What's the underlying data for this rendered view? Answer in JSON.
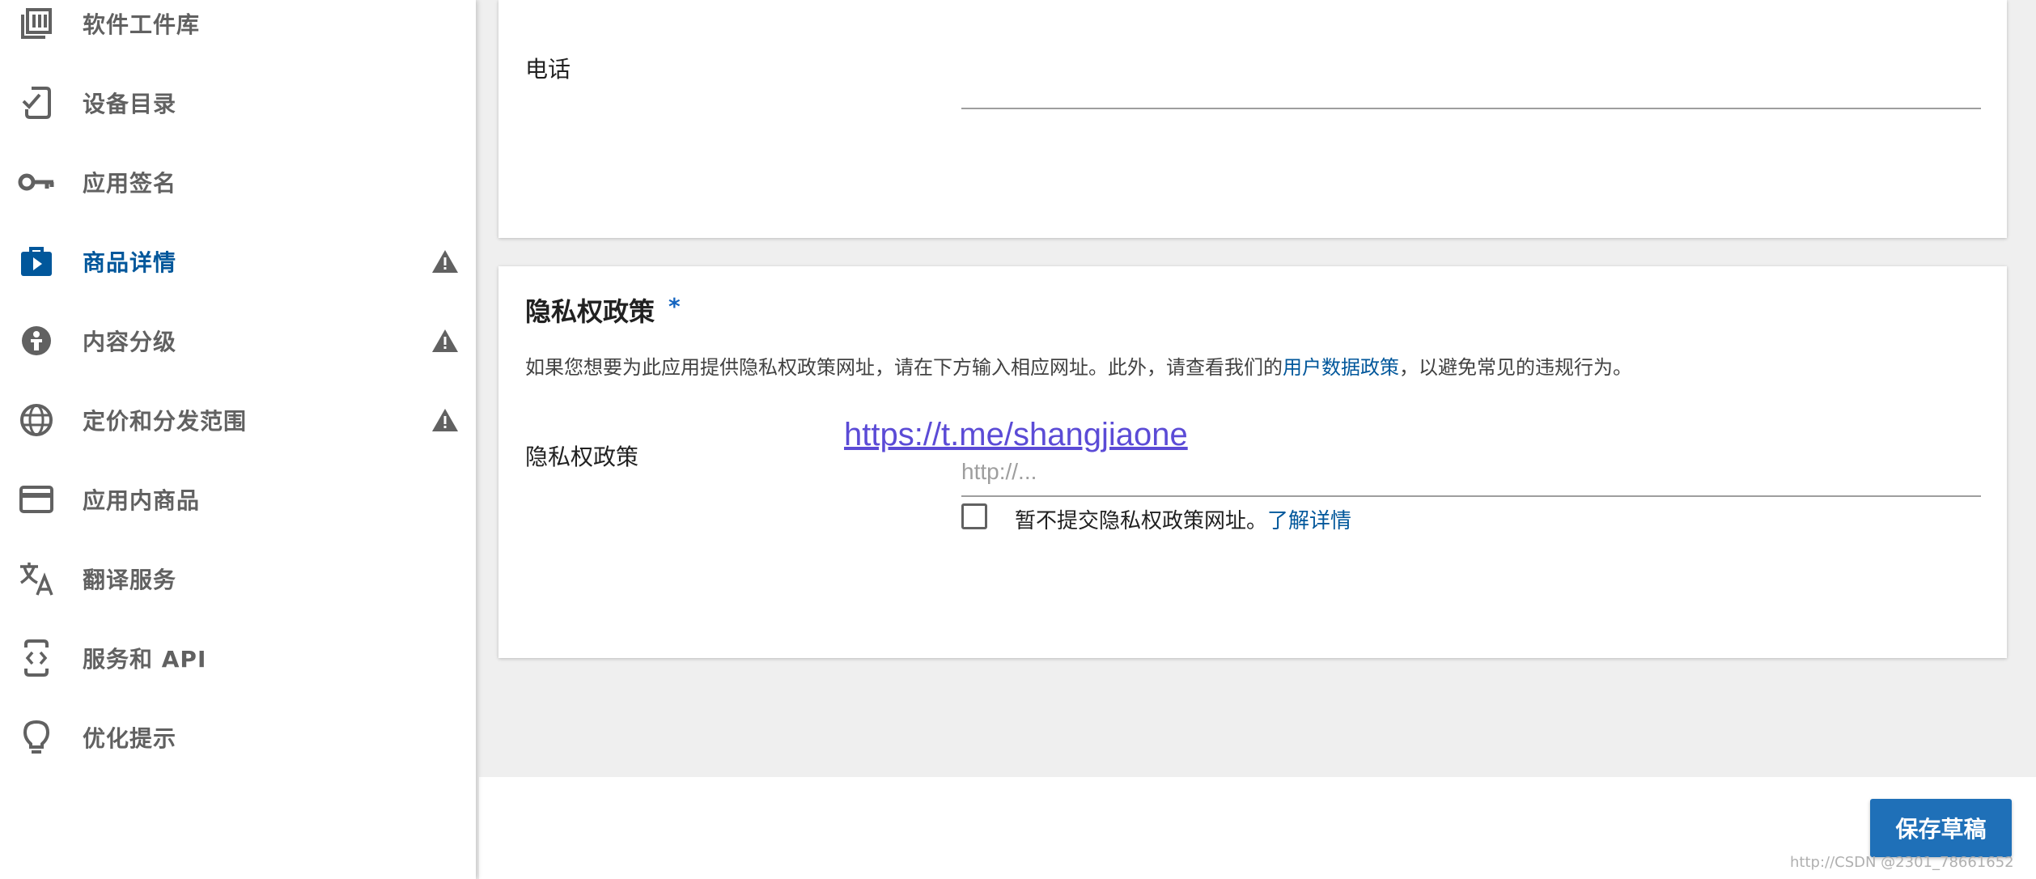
{
  "sidebar": {
    "items": [
      {
        "label": "软件工件库",
        "icon": "library-icon"
      },
      {
        "label": "设备目录",
        "icon": "device-check-icon"
      },
      {
        "label": "应用签名",
        "icon": "key-icon"
      },
      {
        "label": "商品详情",
        "icon": "store-listing-icon",
        "active": true,
        "warning": true
      },
      {
        "label": "内容分级",
        "icon": "content-rating-icon",
        "warning": true
      },
      {
        "label": "定价和分发范围",
        "icon": "globe-icon",
        "warning": true
      },
      {
        "label": "应用内商品",
        "icon": "credit-card-icon"
      },
      {
        "label": "翻译服务",
        "icon": "translate-icon"
      },
      {
        "label": "服务和 API",
        "icon": "api-icon"
      },
      {
        "label": "优化提示",
        "icon": "lightbulb-icon"
      }
    ]
  },
  "contact": {
    "phone_label": "电话"
  },
  "privacy": {
    "title": "隐私权政策",
    "required_mark": "*",
    "description_before": "如果您想要为此应用提供隐私权政策网址，请在下方输入相应网址。此外，请查看我们的",
    "description_link": "用户数据政策",
    "description_after": "，以避免常见的违规行为。",
    "field_label": "隐私权政策",
    "overlay_link": "https://t.me/shangjiaone",
    "url_placeholder": "http://...",
    "checkbox_label": "暂不提交隐私权政策网址。",
    "learn_more": "了解详情"
  },
  "footer": {
    "save_label": "保存草稿",
    "watermark": "http://CSDN @2301_78661652"
  },
  "colors": {
    "accent": "#01579b",
    "button": "#1f70b8",
    "warning": "#616161"
  }
}
